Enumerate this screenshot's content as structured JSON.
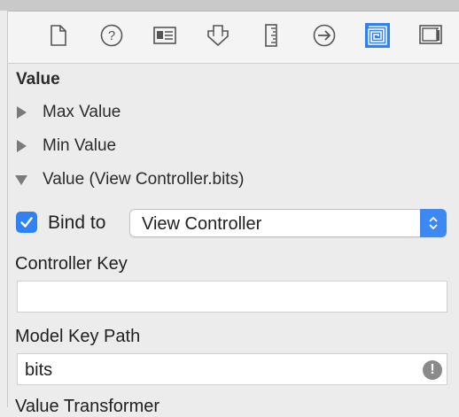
{
  "toolbar": {
    "icons": [
      {
        "name": "file-inspector-icon"
      },
      {
        "name": "quick-help-icon"
      },
      {
        "name": "identity-inspector-icon"
      },
      {
        "name": "attributes-inspector-icon"
      },
      {
        "name": "size-inspector-icon"
      },
      {
        "name": "connections-inspector-icon"
      },
      {
        "name": "bindings-inspector-icon",
        "active": true
      },
      {
        "name": "view-effects-inspector-icon"
      }
    ],
    "accent": "#2f82f5"
  },
  "section": {
    "title": "Value",
    "items": [
      {
        "label": "Max Value",
        "expanded": false
      },
      {
        "label": "Min Value",
        "expanded": false
      },
      {
        "label": "Value (View Controller.bits)",
        "expanded": true
      }
    ]
  },
  "binding": {
    "checkbox_label": "Bind to",
    "checked": true,
    "target": "View Controller"
  },
  "controller_key": {
    "label": "Controller Key",
    "value": ""
  },
  "model_key_path": {
    "label": "Model Key Path",
    "value": "bits",
    "warning_icon": "exclamation-icon"
  },
  "value_transformer": {
    "label": "Value Transformer"
  }
}
